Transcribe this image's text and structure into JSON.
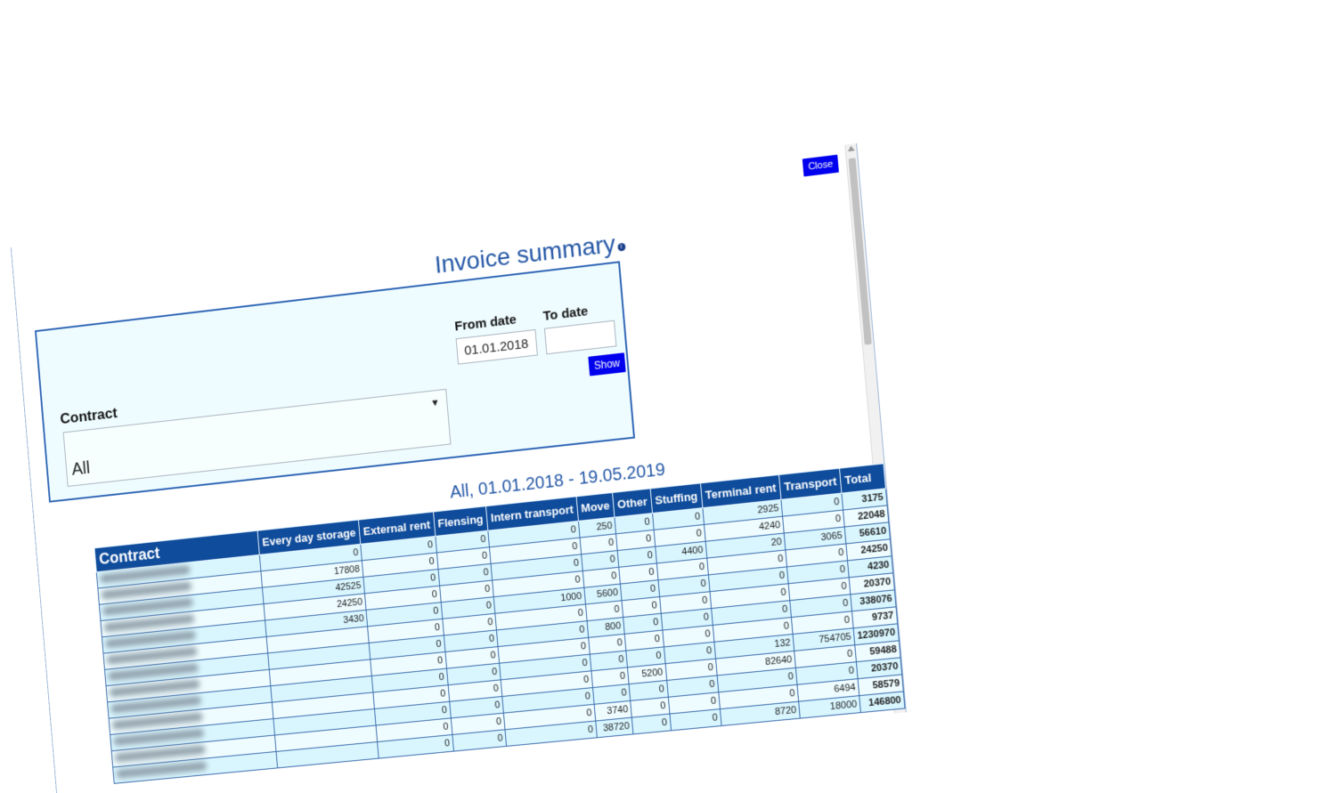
{
  "close_label": "Close",
  "title": "Invoice summary",
  "info_icon": "info-icon",
  "filter": {
    "contract_label": "Contract",
    "contract_value": "All",
    "from_label": "From date",
    "from_value": "01.01.2018",
    "to_label": "To date",
    "to_value": "",
    "show_label": "Show"
  },
  "subtitle": "All, 01.01.2018 - 19.05.2019",
  "table": {
    "headers": [
      "Contract",
      "Every day storage",
      "External rent",
      "Flensing",
      "Intern transport",
      "Move",
      "Other",
      "Stuffing",
      "Terminal rent",
      "Transport",
      "Total"
    ],
    "rows": [
      [
        "",
        "0",
        "0",
        "0",
        "0",
        "250",
        "0",
        "0",
        "2925",
        "0",
        "3175"
      ],
      [
        "",
        "17808",
        "0",
        "0",
        "0",
        "0",
        "0",
        "0",
        "4240",
        "0",
        "22048"
      ],
      [
        "",
        "42525",
        "0",
        "0",
        "0",
        "0",
        "0",
        "4400",
        "20",
        "3065",
        "56610"
      ],
      [
        "",
        "24250",
        "0",
        "0",
        "0",
        "0",
        "0",
        "0",
        "0",
        "0",
        "24250"
      ],
      [
        "",
        "3430",
        "0",
        "0",
        "1000",
        "5600",
        "0",
        "0",
        "0",
        "0",
        "4230"
      ],
      [
        "",
        "",
        "0",
        "0",
        "0",
        "0",
        "0",
        "0",
        "0",
        "0",
        "20370"
      ],
      [
        "",
        "",
        "0",
        "0",
        "0",
        "800",
        "0",
        "0",
        "0",
        "0",
        "338076"
      ],
      [
        "",
        "",
        "0",
        "0",
        "0",
        "0",
        "0",
        "0",
        "0",
        "0",
        "9737"
      ],
      [
        "",
        "",
        "0",
        "0",
        "0",
        "0",
        "0",
        "0",
        "132",
        "754705",
        "1230970"
      ],
      [
        "",
        "",
        "0",
        "0",
        "0",
        "0",
        "5200",
        "0",
        "82640",
        "0",
        "59488"
      ],
      [
        "",
        "",
        "0",
        "0",
        "0",
        "0",
        "0",
        "0",
        "0",
        "0",
        "20370"
      ],
      [
        "",
        "",
        "0",
        "0",
        "0",
        "3740",
        "0",
        "0",
        "0",
        "6494",
        "58579"
      ],
      [
        "",
        "",
        "0",
        "0",
        "0",
        "38720",
        "0",
        "0",
        "8720",
        "18000",
        "146800"
      ]
    ]
  }
}
